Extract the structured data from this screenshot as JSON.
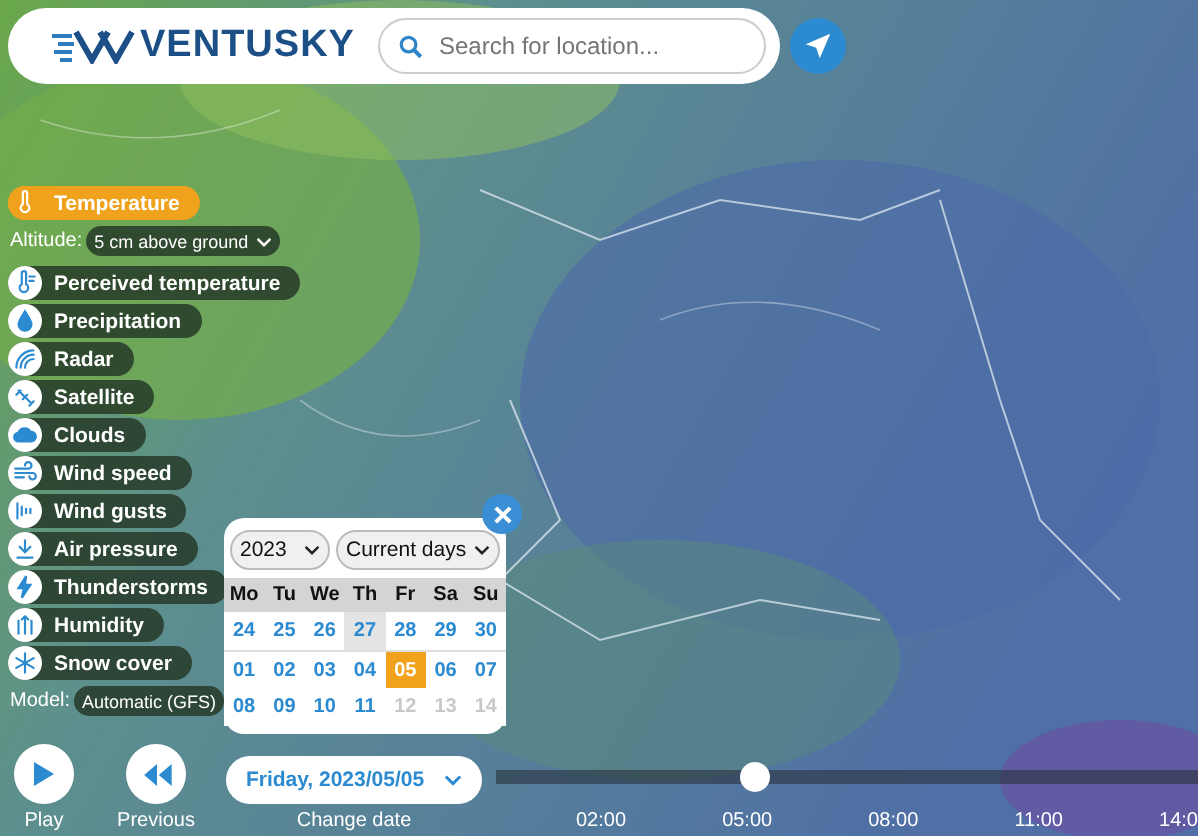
{
  "header": {
    "logo": "VENTUSKY",
    "search": {
      "placeholder": "Search for location..."
    }
  },
  "layers": [
    {
      "label": "Temperature",
      "selected": true
    },
    {
      "label": "Perceived temperature",
      "selected": false
    },
    {
      "label": "Precipitation",
      "selected": false
    },
    {
      "label": "Radar",
      "selected": false
    },
    {
      "label": "Satellite",
      "selected": false
    },
    {
      "label": "Clouds",
      "selected": false
    },
    {
      "label": "Wind speed",
      "selected": false
    },
    {
      "label": "Wind gusts",
      "selected": false
    },
    {
      "label": "Air pressure",
      "selected": false
    },
    {
      "label": "Thunderstorms",
      "selected": false
    },
    {
      "label": "Humidity",
      "selected": false
    },
    {
      "label": "Snow cover",
      "selected": false
    }
  ],
  "altitude": {
    "label": "Altitude:",
    "value": "5 cm above ground"
  },
  "model": {
    "label": "Model:",
    "value": "Automatic (GFS)"
  },
  "calendar": {
    "year": "2023",
    "range": "Current days",
    "weekdays": [
      "Mo",
      "Tu",
      "We",
      "Th",
      "Fr",
      "Sa",
      "Su"
    ],
    "weeks": [
      [
        {
          "day": "24",
          "selected": false,
          "today": false,
          "disabled": false
        },
        {
          "day": "25",
          "selected": false,
          "today": false,
          "disabled": false
        },
        {
          "day": "26",
          "selected": false,
          "today": false,
          "disabled": false
        },
        {
          "day": "27",
          "selected": false,
          "today": true,
          "disabled": false
        },
        {
          "day": "28",
          "selected": false,
          "today": false,
          "disabled": false
        },
        {
          "day": "29",
          "selected": false,
          "today": false,
          "disabled": false
        },
        {
          "day": "30",
          "selected": false,
          "today": false,
          "disabled": false
        }
      ],
      [
        {
          "day": "01",
          "selected": false,
          "today": false,
          "disabled": false
        },
        {
          "day": "02",
          "selected": false,
          "today": false,
          "disabled": false
        },
        {
          "day": "03",
          "selected": false,
          "today": false,
          "disabled": false
        },
        {
          "day": "04",
          "selected": false,
          "today": false,
          "disabled": false
        },
        {
          "day": "05",
          "selected": true,
          "today": false,
          "disabled": false
        },
        {
          "day": "06",
          "selected": false,
          "today": false,
          "disabled": false
        },
        {
          "day": "07",
          "selected": false,
          "today": false,
          "disabled": false
        }
      ],
      [
        {
          "day": "08",
          "selected": false,
          "today": false,
          "disabled": false
        },
        {
          "day": "09",
          "selected": false,
          "today": false,
          "disabled": false
        },
        {
          "day": "10",
          "selected": false,
          "today": false,
          "disabled": false
        },
        {
          "day": "11",
          "selected": false,
          "today": false,
          "disabled": false
        },
        {
          "day": "12",
          "selected": false,
          "today": false,
          "disabled": true
        },
        {
          "day": "13",
          "selected": false,
          "today": false,
          "disabled": true
        },
        {
          "day": "14",
          "selected": false,
          "today": false,
          "disabled": true
        }
      ]
    ]
  },
  "controls": {
    "play": "Play",
    "previous": "Previous",
    "date": "Friday, 2023/05/05",
    "change_date": "Change date"
  },
  "timeline": {
    "level": 0.37,
    "times": [
      "02:00",
      "05:00",
      "08:00",
      "11:00",
      "14:0"
    ]
  }
}
